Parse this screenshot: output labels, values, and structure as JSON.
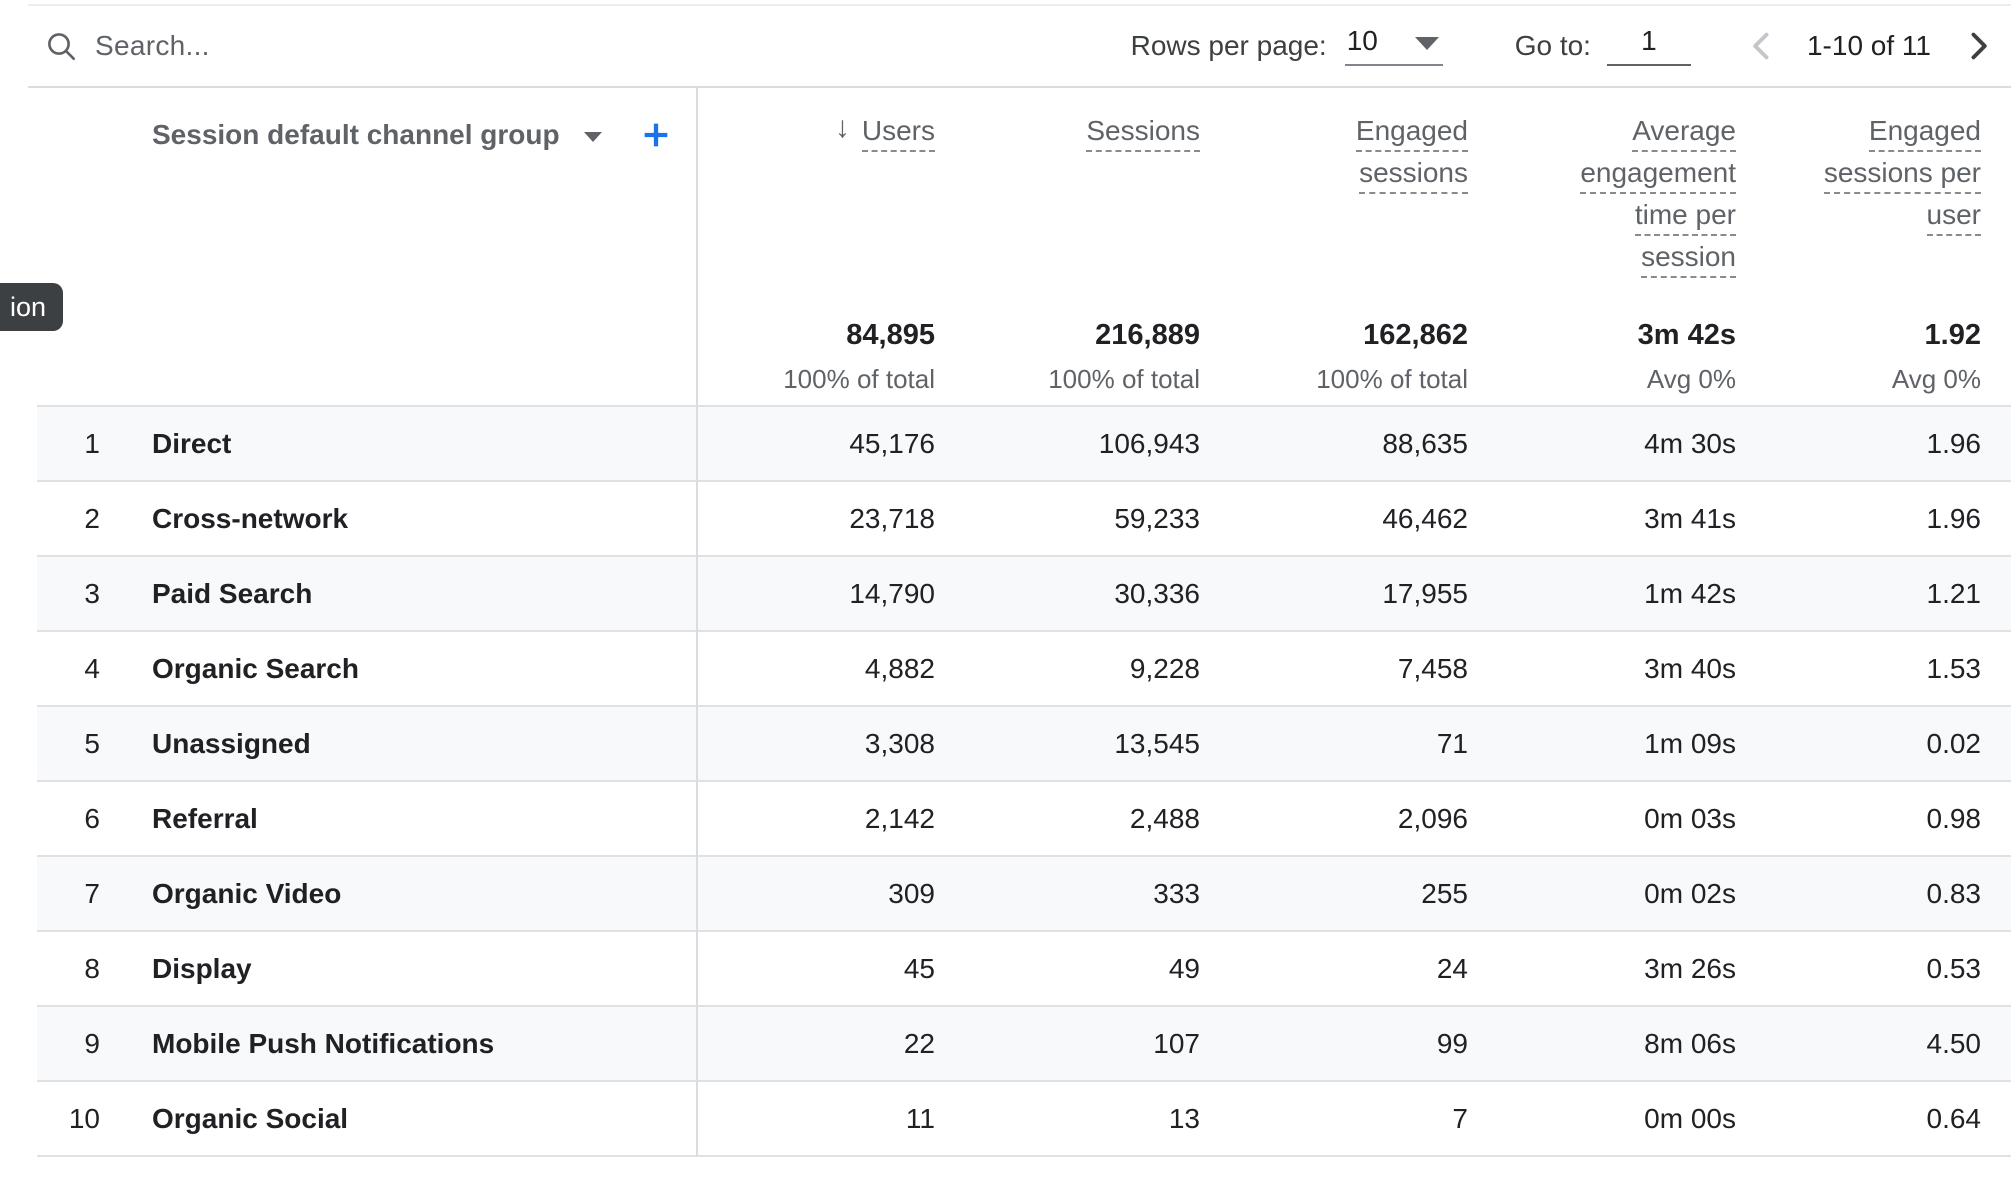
{
  "toolbar": {
    "search_placeholder": "Search...",
    "rows_per_page_label": "Rows per page:",
    "rows_per_page_value": "10",
    "go_to_label": "Go to:",
    "go_to_value": "1",
    "pagination_range": "1-10 of 11"
  },
  "tooltip_fragment": "ion",
  "icons": {
    "search": "magnifier-outline",
    "sort_descending": "↓",
    "dropdown_caret": "filled-triangle-down",
    "add": "plus",
    "previous_page": "chevron-left",
    "next_page": "chevron-right"
  },
  "colors": {
    "text_dark": "#202124",
    "text_gray": "#5f6368",
    "accent_blue": "#1a73e8",
    "row_stripe": "#f8f9fa",
    "border": "#dadce0",
    "tooltip_bg": "#3c4043",
    "disabled_chevron": "#c2c7cc"
  },
  "table": {
    "dimension_header": {
      "label": "Session default channel group"
    },
    "metric_headers": [
      {
        "id": "users",
        "lines": [
          "Users"
        ],
        "sorted": true
      },
      {
        "id": "sessions",
        "lines": [
          "Sessions"
        ],
        "sorted": false
      },
      {
        "id": "engaged-sessions",
        "lines": [
          "Engaged",
          "sessions"
        ],
        "sorted": false
      },
      {
        "id": "average-engagement-time-per-session",
        "lines": [
          "Average",
          "engagement",
          "time per",
          "session"
        ],
        "sorted": false
      },
      {
        "id": "engaged-sessions-per-user",
        "lines": [
          "Engaged",
          "sessions per",
          "user"
        ],
        "sorted": false
      }
    ],
    "totals": [
      {
        "value": "84,895",
        "sub": "100% of total"
      },
      {
        "value": "216,889",
        "sub": "100% of total"
      },
      {
        "value": "162,862",
        "sub": "100% of total"
      },
      {
        "value": "3m 42s",
        "sub": "Avg 0%"
      },
      {
        "value": "1.92",
        "sub": "Avg 0%"
      }
    ],
    "rows": [
      {
        "num": "1",
        "dimension": "Direct",
        "metrics": [
          "45,176",
          "106,943",
          "88,635",
          "4m 30s",
          "1.96"
        ]
      },
      {
        "num": "2",
        "dimension": "Cross-network",
        "metrics": [
          "23,718",
          "59,233",
          "46,462",
          "3m 41s",
          "1.96"
        ]
      },
      {
        "num": "3",
        "dimension": "Paid Search",
        "metrics": [
          "14,790",
          "30,336",
          "17,955",
          "1m 42s",
          "1.21"
        ]
      },
      {
        "num": "4",
        "dimension": "Organic Search",
        "metrics": [
          "4,882",
          "9,228",
          "7,458",
          "3m 40s",
          "1.53"
        ]
      },
      {
        "num": "5",
        "dimension": "Unassigned",
        "metrics": [
          "3,308",
          "13,545",
          "71",
          "1m 09s",
          "0.02"
        ]
      },
      {
        "num": "6",
        "dimension": "Referral",
        "metrics": [
          "2,142",
          "2,488",
          "2,096",
          "0m 03s",
          "0.98"
        ]
      },
      {
        "num": "7",
        "dimension": "Organic Video",
        "metrics": [
          "309",
          "333",
          "255",
          "0m 02s",
          "0.83"
        ]
      },
      {
        "num": "8",
        "dimension": "Display",
        "metrics": [
          "45",
          "49",
          "24",
          "3m 26s",
          "0.53"
        ]
      },
      {
        "num": "9",
        "dimension": "Mobile Push Notifications",
        "metrics": [
          "22",
          "107",
          "99",
          "8m 06s",
          "4.50"
        ]
      },
      {
        "num": "10",
        "dimension": "Organic Social",
        "metrics": [
          "11",
          "13",
          "7",
          "0m 00s",
          "0.64"
        ]
      }
    ]
  }
}
